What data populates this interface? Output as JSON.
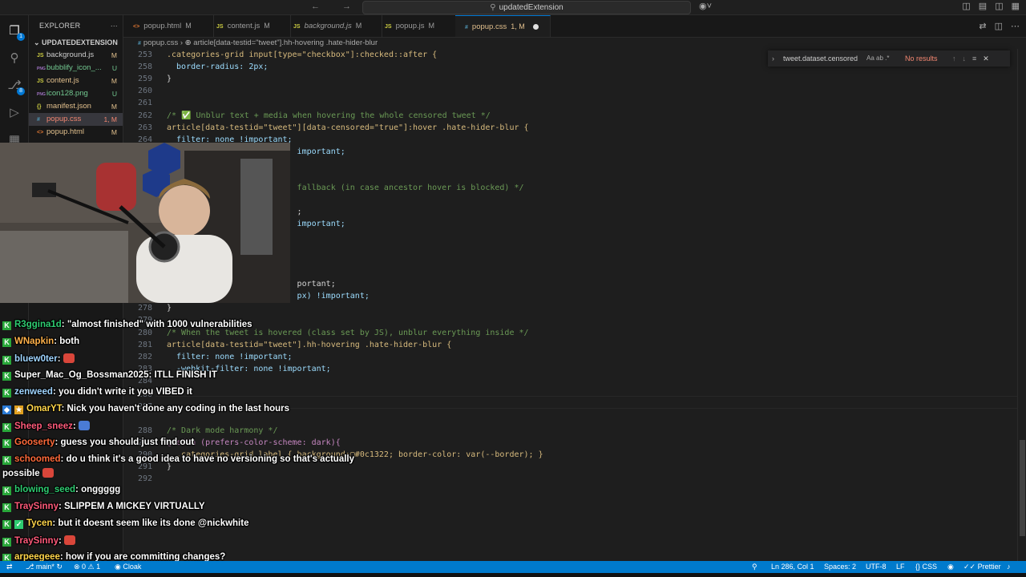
{
  "titlebar": {
    "back_icon": "arrow-left-icon",
    "forward_icon": "arrow-right-icon",
    "search_title": "updatedExtension",
    "copilot_icon": "copilot-icon"
  },
  "activity": {
    "explorer_badge": "1",
    "scm_badge": "8"
  },
  "sidebar": {
    "title": "EXPLORER",
    "folder": "UPDATEDEXTENSION",
    "files": [
      {
        "name": "background.js",
        "icon": "JS",
        "status": "M"
      },
      {
        "name": "bubblify_icon_...",
        "icon": "PNG",
        "status": "U"
      },
      {
        "name": "content.js",
        "icon": "JS",
        "status": "M"
      },
      {
        "name": "icon128.png",
        "icon": "PNG",
        "status": "U"
      },
      {
        "name": "manifest.json",
        "icon": "{}",
        "status": "M"
      },
      {
        "name": "popup.css",
        "icon": "#",
        "status": "1, M"
      },
      {
        "name": "popup.html",
        "icon": "<>",
        "status": "M"
      }
    ]
  },
  "tabs": [
    {
      "label": "popup.html",
      "icon": "<>",
      "status": "M"
    },
    {
      "label": "content.js",
      "icon": "JS",
      "status": "M"
    },
    {
      "label": "background.js",
      "icon": "JS",
      "status": "M"
    },
    {
      "label": "popup.js",
      "icon": "JS",
      "status": "M"
    },
    {
      "label": "popup.css",
      "icon": "#",
      "status": "1, M"
    }
  ],
  "breadcrumb": {
    "file": "popup.css",
    "symbol": "article[data-testid=\"tweet\"].hh-hovering .hate-hider-blur"
  },
  "find": {
    "query": "tweet.dataset.censored",
    "result": "No results"
  },
  "editor": {
    "lines": [
      {
        "n": "253",
        "code": ".categories-grid input[type=\"checkbox\"]:checked::after {"
      },
      {
        "n": "258",
        "code": "  border-radius: 2px;"
      },
      {
        "n": "259",
        "code": "}"
      },
      {
        "n": "260",
        "code": ""
      },
      {
        "n": "261",
        "code": ""
      },
      {
        "n": "262",
        "code": "/* ✅ Unblur text + media when hovering the whole censored tweet */"
      },
      {
        "n": "263",
        "code": "article[data-testid=\"tweet\"][data-censored=\"true\"]:hover .hate-hider-blur {"
      },
      {
        "n": "264",
        "code": "  filter: none !important;"
      },
      {
        "n": "",
        "code": "                           important;"
      },
      {
        "n": "",
        "code": ""
      },
      {
        "n": "",
        "code": ""
      },
      {
        "n": "",
        "code": "                           fallback (in case ancestor hover is blocked) */"
      },
      {
        "n": "",
        "code": ""
      },
      {
        "n": "",
        "code": "                           ;"
      },
      {
        "n": "",
        "code": "                           important;"
      },
      {
        "n": "",
        "code": ""
      },
      {
        "n": "",
        "code": ""
      },
      {
        "n": "",
        "code": ""
      },
      {
        "n": "",
        "code": ""
      },
      {
        "n": "",
        "code": "                           portant;"
      },
      {
        "n": "",
        "code": "                           px) !important;"
      },
      {
        "n": "278",
        "code": "}"
      },
      {
        "n": "279",
        "code": ""
      },
      {
        "n": "280",
        "code": "/* When the tweet is hovered (class set by JS), unblur everything inside */"
      },
      {
        "n": "281",
        "code": "article[data-testid=\"tweet\"].hh-hovering .hate-hider-blur {"
      },
      {
        "n": "282",
        "code": "  filter: none !important;"
      },
      {
        "n": "283",
        "code": "  -webkit-filter: none !important;"
      },
      {
        "n": "284",
        "code": ""
      },
      {
        "n": "286",
        "code": ""
      },
      {
        "n": "287",
        "code": ""
      },
      {
        "n": "288",
        "code": "/* Dark mode harmony */"
      },
      {
        "n": "289",
        "code": "@media (prefers-color-scheme: dark){"
      },
      {
        "n": "290",
        "code": "  .categories-grid label { background:▢#0c1322; border-color: var(--border); }"
      },
      {
        "n": "291",
        "code": "}"
      },
      {
        "n": "292",
        "code": ""
      }
    ]
  },
  "chat": [
    {
      "user": "R3ggina1d",
      "color": "#2ecc71",
      "text": ": \"almost finished\" with 1000 vulnerabilities"
    },
    {
      "user": "WNapkin",
      "color": "#ffb14a",
      "text": ": both"
    },
    {
      "user": "bluew0ter",
      "color": "#9fd4ff",
      "text": ": "
    },
    {
      "user": "Super_Mac_Og_Bossman2025",
      "color": "#ffffff",
      "text": ": ITLL FINISH IT"
    },
    {
      "user": "zenweed",
      "color": "#9fd4ff",
      "text": ": you didn't write it you VIBED it"
    },
    {
      "user": "OmarYT",
      "color": "#ffd54a",
      "text": ": Nick you haven't done any coding in the last hours"
    },
    {
      "user": "Sheep_sneez",
      "color": "#ff5a7a",
      "text": ": "
    },
    {
      "user": "Gooserty",
      "color": "#ff6a3a",
      "text": ": guess you should just find out"
    },
    {
      "user": "schoomed",
      "color": "#ff6a3a",
      "text": ": do u think it's a good idea to have no versioning so that's actually"
    },
    {
      "user": "",
      "color": "#ffffff",
      "text": "possible"
    },
    {
      "user": "blowing_seed",
      "color": "#2ecc71",
      "text": ": onggggg"
    },
    {
      "user": "TraySinny",
      "color": "#ff5a7a",
      "text": ": SLIPPEM A MICKEY VIRTUALLY"
    },
    {
      "user": "Tycen",
      "color": "#ffd54a",
      "text": ": but it doesnt seem like its done @nickwhite"
    },
    {
      "user": "TraySinny",
      "color": "#ff5a7a",
      "text": ": "
    },
    {
      "user": "arpeegeee",
      "color": "#ffd54a",
      "text": ": how if you are committing changes?"
    }
  ],
  "status": {
    "branch": "main*",
    "sync_icon": "sync-icon",
    "problems": "⊗ 0 ⚠ 1",
    "cloak": "Cloak",
    "position": "Ln 286, Col 1",
    "spaces": "Spaces: 2",
    "encoding": "UTF-8",
    "eol": "LF",
    "language": "CSS",
    "prettier": "Prettier"
  },
  "colors": {
    "accent": "#007acc",
    "editor_bg": "#1e1e1e",
    "modified": "#e2c08d",
    "untracked": "#73c991"
  }
}
